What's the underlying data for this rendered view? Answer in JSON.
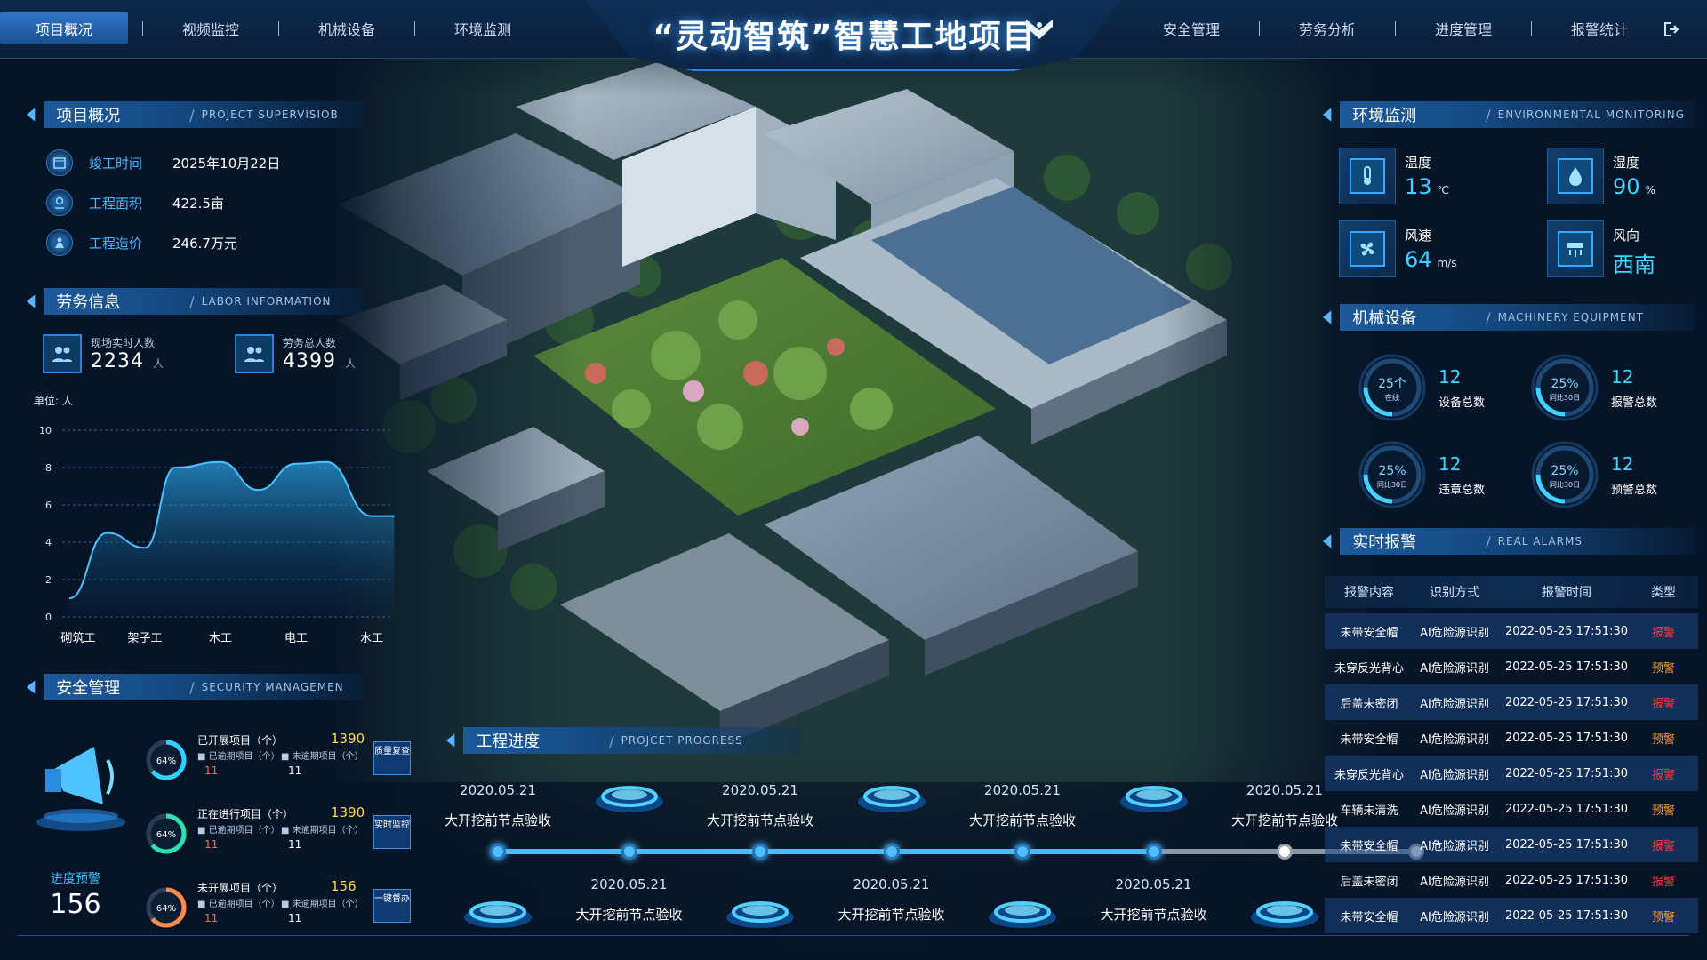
{
  "nav": {
    "left": [
      "项目概况",
      "视频监控",
      "机械设备",
      "环境监测"
    ],
    "right": [
      "安全管理",
      "劳务分析",
      "进度管理",
      "报警统计"
    ],
    "active": "项目概况",
    "title": "“灵动智筑”智慧工地项目"
  },
  "overview": {
    "header": "项目概况",
    "header_en": "PROJECT SUPERVISIOB",
    "rows": [
      {
        "icon": "calendar-icon",
        "label": "竣工时间",
        "value": "2025年10月22日"
      },
      {
        "icon": "location-icon",
        "label": "工程面积",
        "value": "422.5亩"
      },
      {
        "icon": "worker-icon",
        "label": "工程造价",
        "value": "246.7万元"
      }
    ]
  },
  "labor": {
    "header": "劳务信息",
    "header_en": "LABOR INFORMATION",
    "onsite_label": "现场实时人数",
    "onsite_value": "2234",
    "total_label": "劳务总人数",
    "total_value": "4399",
    "unit": "人",
    "chart_unit": "单位: 人"
  },
  "chart_data": {
    "type": "area",
    "categories": [
      "砌筑工",
      "架子工",
      "木工",
      "电工",
      "水工"
    ],
    "values": [
      4.5,
      4.2,
      8.0,
      6.8,
      8.2
    ],
    "curve_x": [
      0,
      0.5,
      1,
      1.4,
      2,
      2.5,
      3,
      3.4,
      4,
      4.3
    ],
    "curve_y": [
      1,
      4.5,
      3.7,
      8.0,
      8.3,
      6.8,
      8.2,
      8.3,
      5.4,
      5.4
    ],
    "ylim": [
      0,
      10
    ],
    "yticks": [
      "0",
      "2",
      "4",
      "6",
      "8",
      "10"
    ]
  },
  "safety": {
    "header": "安全管理",
    "header_en": "SECURITY MANAGEMEN",
    "warn_label": "进度预警",
    "warn_value": "156",
    "rows": [
      {
        "title": "已开展项目（个）",
        "total": "1390",
        "pct": "64%",
        "sub1": "■ 已逾期项目（个）",
        "sub2": "■ 未逾期项目（个）",
        "v1": "11",
        "v2": "11",
        "btn": "质量复查",
        "color": "#2fd2ff"
      },
      {
        "title": "正在进行项目（个）",
        "total": "1390",
        "pct": "64%",
        "sub1": "■ 已逾期项目（个）",
        "sub2": "■ 未逾期项目（个）",
        "v1": "11",
        "v2": "11",
        "btn": "实时监控",
        "color": "#2fe0b0"
      },
      {
        "title": "未开展项目（个）",
        "total": "156",
        "pct": "64%",
        "sub1": "■ 已逾期项目（个）",
        "sub2": "■ 未逾期项目（个）",
        "v1": "11",
        "v2": "11",
        "btn": "一键督办",
        "color": "#ff8a4a"
      }
    ]
  },
  "env": {
    "header": "环境监测",
    "header_en": "ENVIRONMENTAL MONITORING",
    "items": [
      {
        "label": "温度",
        "value": "13",
        "unit": "℃",
        "icon": "thermometer-icon"
      },
      {
        "label": "湿度",
        "value": "90",
        "unit": "%",
        "icon": "humidity-icon"
      },
      {
        "label": "风速",
        "value": "64",
        "unit": "m/s",
        "icon": "fan-icon"
      },
      {
        "label": "风向",
        "value": "西南",
        "unit": "",
        "icon": "wind-direction-icon"
      }
    ]
  },
  "machinery": {
    "header": "机械设备",
    "header_en": "MACHINERY EQUIPMENT",
    "items": [
      {
        "pct": "25个",
        "sub": "在线",
        "num": "12",
        "label": "设备总数",
        "fraction": 0.25
      },
      {
        "pct": "25%",
        "sub": "同比30日",
        "num": "12",
        "label": "报警总数",
        "fraction": 0.25
      },
      {
        "pct": "25%",
        "sub": "同比30日",
        "num": "12",
        "label": "违章总数",
        "fraction": 0.25
      },
      {
        "pct": "25%",
        "sub": "同比30日",
        "num": "12",
        "label": "预警总数",
        "fraction": 0.25
      }
    ]
  },
  "alarms": {
    "header": "实时报警",
    "header_en": "REAL ALARMS",
    "columns": [
      "报警内容",
      "识别方式",
      "报警时间",
      "类型"
    ],
    "rows": [
      [
        "未带安全帽",
        "AI危险源识别",
        "2022-05-25 17:51:30",
        "报警"
      ],
      [
        "未穿反光背心",
        "AI危险源识别",
        "2022-05-25 17:51:30",
        "预警"
      ],
      [
        "后盖未密闭",
        "AI危险源识别",
        "2022-05-25 17:51:30",
        "报警"
      ],
      [
        "未带安全帽",
        "AI危险源识别",
        "2022-05-25 17:51:30",
        "预警"
      ],
      [
        "未穿反光背心",
        "AI危险源识别",
        "2022-05-25 17:51:30",
        "报警"
      ],
      [
        "车辆未清洗",
        "AI危险源识别",
        "2022-05-25 17:51:30",
        "预警"
      ],
      [
        "未带安全帽",
        "AI危险源识别",
        "2022-05-25 17:51:30",
        "报警"
      ],
      [
        "后盖未密闭",
        "AI危险源识别",
        "2022-05-25 17:51:30",
        "报警"
      ],
      [
        "未带安全帽",
        "AI危险源识别",
        "2022-05-25 17:51:30",
        "预警"
      ]
    ],
    "colors": {
      "报警": "#ff3b3b",
      "预警": "#ff9a2e"
    }
  },
  "progress": {
    "header": "工程进度",
    "header_en": "PROJCET PROGRESS",
    "milestones": [
      {
        "date": "2020.05.21",
        "label": "大开挖前节点验收",
        "done": true
      },
      {
        "date": "2020.05.21",
        "label": "大开挖前节点验收",
        "done": true
      },
      {
        "date": "2020.05.21",
        "label": "大开挖前节点验收",
        "done": true
      },
      {
        "date": "2020.05.21",
        "label": "大开挖前节点验收",
        "done": true
      },
      {
        "date": "2020.05.21",
        "label": "大开挖前节点验收",
        "done": true
      },
      {
        "date": "2020.05.21",
        "label": "大开挖前节点验收",
        "done": true
      },
      {
        "date": "2020.05.21",
        "label": "大开挖前节点验收",
        "done": false
      },
      {
        "date": "",
        "label": "",
        "done": false
      }
    ]
  }
}
